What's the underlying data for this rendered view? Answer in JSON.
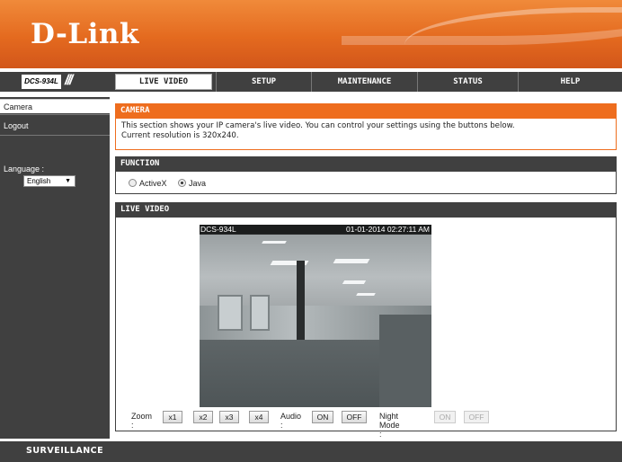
{
  "brand": {
    "logo": "D-Link",
    "model": "DCS-934L",
    "slashes": "///"
  },
  "tabs": [
    {
      "label": "LIVE VIDEO",
      "active": true
    },
    {
      "label": "SETUP",
      "active": false
    },
    {
      "label": "MAINTENANCE",
      "active": false
    },
    {
      "label": "STATUS",
      "active": false
    },
    {
      "label": "HELP",
      "active": false
    }
  ],
  "sidebar": {
    "items": [
      {
        "label": "Camera",
        "active": true
      },
      {
        "label": "Logout",
        "active": false
      }
    ],
    "language_label": "Language :",
    "language_value": "English"
  },
  "camera_section": {
    "title": "CAMERA",
    "desc_line1": "This section shows your IP camera's live video. You can control your settings using the buttons below.",
    "desc_line2": "Current resolution is 320x240."
  },
  "function_section": {
    "title": "FUNCTION",
    "options": [
      {
        "label": "ActiveX",
        "checked": false
      },
      {
        "label": "Java",
        "checked": true
      }
    ]
  },
  "live_video_section": {
    "title": "LIVE VIDEO",
    "osd_name": "DCS-934L",
    "osd_timestamp": "01-01-2014 02:27:11 AM"
  },
  "controls": {
    "zoom_label": "Zoom :",
    "zoom_buttons": [
      "x1",
      "x2",
      "x3",
      "x4"
    ],
    "audio_label": "Audio :",
    "audio_on": "ON",
    "audio_off": "OFF",
    "night_label": "Night Mode :",
    "night_on": "ON",
    "night_off": "OFF",
    "night_enabled": false
  },
  "footer": {
    "text": "SURVEILLANCE"
  },
  "colors": {
    "orange": "#ee6d1e",
    "dark": "#404040"
  }
}
